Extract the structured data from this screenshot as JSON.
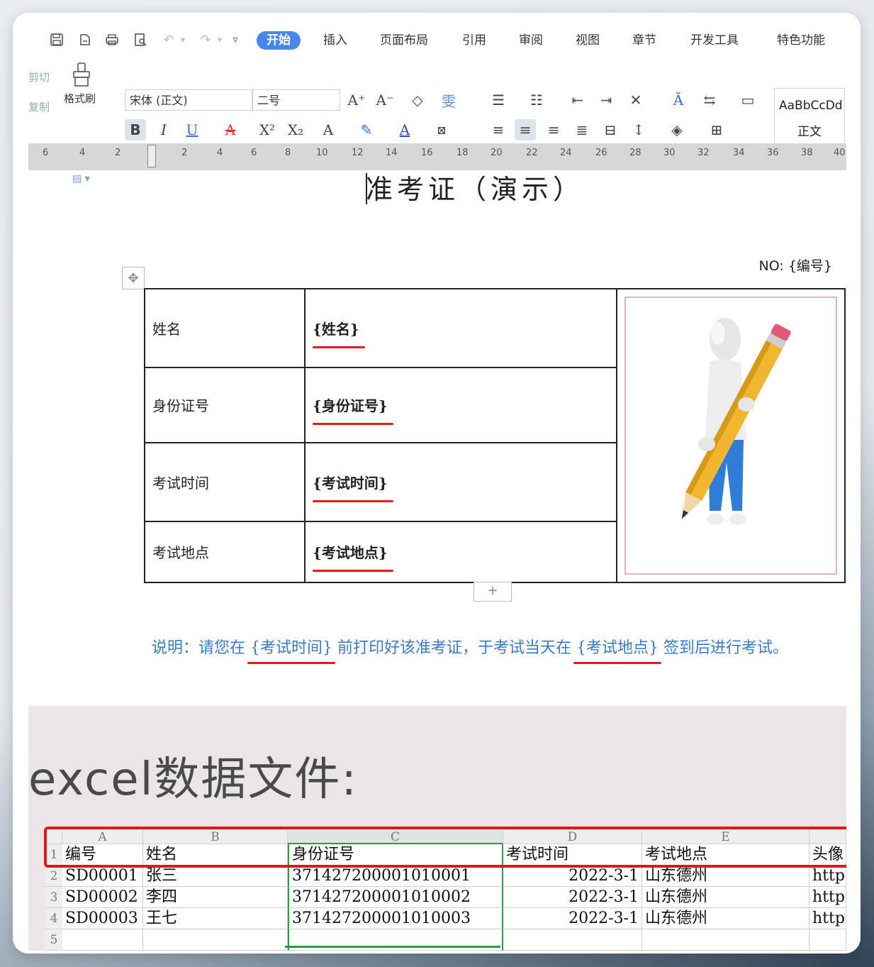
{
  "tabs": [
    "开始",
    "插入",
    "页面布局",
    "引用",
    "审阅",
    "视图",
    "章节",
    "开发工具",
    "特色功能"
  ],
  "active_tab": "开始",
  "ribbon": {
    "cut_label": "剪切",
    "copy_label": "复制",
    "format_painter_label": "格式刷",
    "font_name": "宋体 (正文)",
    "font_size": "二号",
    "style_preview": "AaBbCcDd",
    "style_name": "正文"
  },
  "ruler_marks": [
    "6",
    "4",
    "2",
    "2",
    "4",
    "6",
    "8",
    "10",
    "12",
    "14",
    "16",
    "18",
    "20",
    "22",
    "24",
    "26",
    "28",
    "30",
    "32",
    "34",
    "36",
    "38",
    "40"
  ],
  "document": {
    "title": "准考证（演示）",
    "no_label": "NO: {编号}",
    "rows": [
      {
        "label": "姓名",
        "value": "{姓名}"
      },
      {
        "label": "身份证号",
        "value": "{身份证号}"
      },
      {
        "label": "考试时间",
        "value": "{考试时间}"
      },
      {
        "label": "考试地点",
        "value": "{考试地点}"
      }
    ],
    "note_prefix": "说明：请您在 ",
    "note_ph1": "{考试时间}",
    "note_mid": " 前打印好该准考证，于考试当天在 ",
    "note_ph2": "{考试地点}",
    "note_suffix": " 签到后进行考试。"
  },
  "excel": {
    "heading": "excel数据文件:",
    "columns": [
      "A",
      "B",
      "C",
      "D",
      "E"
    ],
    "row_numbers": [
      "1",
      "2",
      "3",
      "4",
      "5"
    ],
    "header_row": [
      "编号",
      "姓名",
      "身份证号",
      "考试时间",
      "考试地点",
      "头像"
    ],
    "rows": [
      [
        "SD00001",
        "张三",
        "371427200001010001",
        "2022-3-1",
        "山东德州",
        "http"
      ],
      [
        "SD00002",
        "李四",
        "371427200001010002",
        "2022-3-1",
        "山东德州",
        "http"
      ],
      [
        "SD00003",
        "王七",
        "371427200001010003",
        "2022-3-1",
        "山东德州",
        "http"
      ]
    ]
  },
  "colors": {
    "accent": "#4a86e8",
    "note_text": "#3a79c9",
    "underline_red": "#e21b1b",
    "excel_select_green": "#2e9b4a"
  }
}
